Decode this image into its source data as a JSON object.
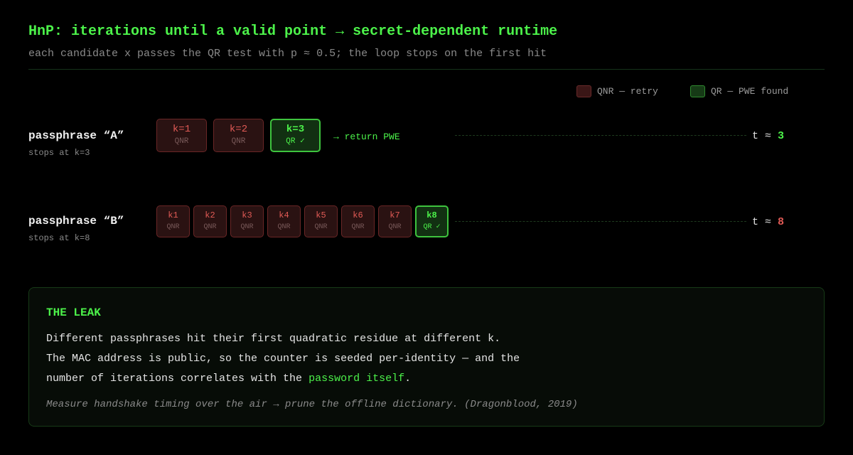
{
  "header": {
    "title": "HnP: iterations until a valid point → secret-dependent runtime",
    "subtitle": "each candidate x passes the QR test with p ≈ 0.5; the loop stops on the first hit"
  },
  "legend": {
    "qnr": "QNR — retry",
    "qr": "QR — PWE found"
  },
  "colors": {
    "accent_green": "#4cf24a",
    "qnr_red": "#e05a55",
    "background": "#000000"
  },
  "row_a": {
    "label": "passphrase “A”",
    "sub": "stops at k=3",
    "boxes": [
      {
        "k": "k=1",
        "status": "QNR"
      },
      {
        "k": "k=2",
        "status": "QNR"
      },
      {
        "k": "k=3",
        "status": "QR ✓"
      }
    ],
    "return_label": "→ return PWE",
    "t_prefix": "t ≈",
    "t_value": "3"
  },
  "row_b": {
    "label": "passphrase “B”",
    "sub": "stops at k=8",
    "boxes": [
      {
        "k": "k1",
        "status": "QNR"
      },
      {
        "k": "k2",
        "status": "QNR"
      },
      {
        "k": "k3",
        "status": "QNR"
      },
      {
        "k": "k4",
        "status": "QNR"
      },
      {
        "k": "k5",
        "status": "QNR"
      },
      {
        "k": "k6",
        "status": "QNR"
      },
      {
        "k": "k7",
        "status": "QNR"
      },
      {
        "k": "k8",
        "status": "QR ✓"
      }
    ],
    "t_prefix": "t ≈",
    "t_value": "8"
  },
  "leak": {
    "title": "THE LEAK",
    "line1": "Different passphrases hit their first quadratic residue at different k.",
    "line2": "The MAC address is public, so the counter is seeded per-identity — and the",
    "line3_pre": "number of iterations correlates with the ",
    "line3_highlight": "password itself",
    "line3_post": ".",
    "note": "Measure handshake timing over the air → prune the offline dictionary. (Dragonblood, 2019)"
  }
}
